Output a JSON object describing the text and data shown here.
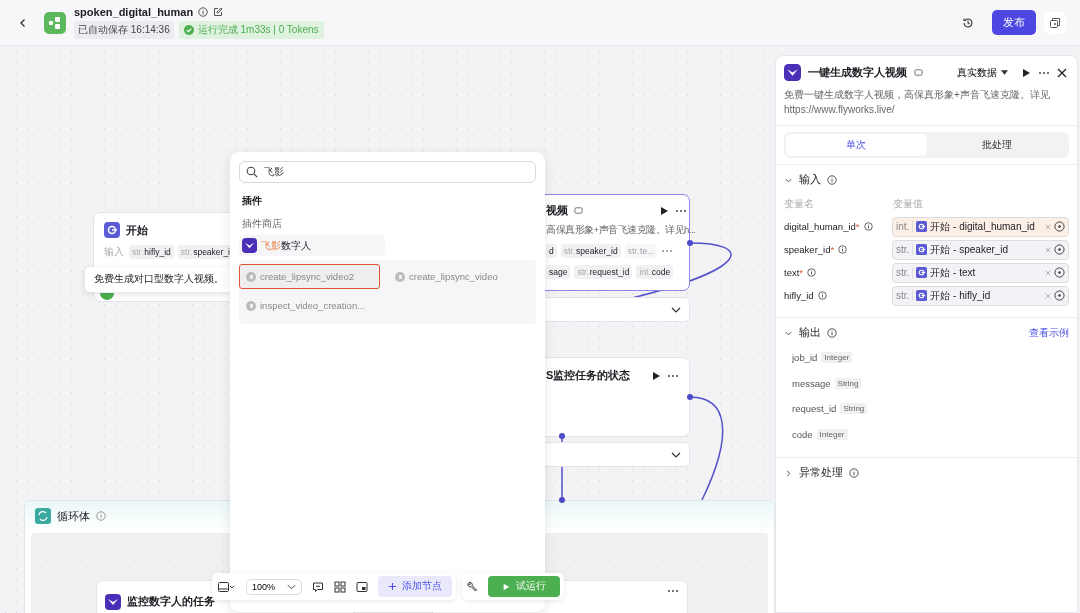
{
  "header": {
    "title": "spoken_digital_human",
    "autosave": "已自动保存 16:14:36",
    "status": "运行完成 1m33s | 0 Tokens",
    "publish": "发布"
  },
  "canvas": {
    "start_node": {
      "title": "开始",
      "input_label": "输入",
      "params": [
        {
          "type": "str.",
          "name": "hifly_id"
        },
        {
          "type": "str.",
          "name": "speaker_i"
        }
      ]
    },
    "tooltip": "免费生成对口型数字人视频。",
    "plugin_node": {
      "title": "视频",
      "description": "高保真形象+声音飞速克隆。详见h...",
      "inputs": [
        {
          "name": "d",
          "faded": false
        },
        {
          "type": "str.",
          "name": "speaker_id",
          "faded": false
        },
        {
          "type": "str.",
          "name": "te...",
          "faded": true
        }
      ],
      "outputs": [
        {
          "name": "sage"
        },
        {
          "type": "str.",
          "name": "request_id"
        },
        {
          "type": "int.",
          "name": "code"
        }
      ]
    },
    "monitor_node": {
      "title": "S监控任务的状态"
    },
    "loop": {
      "title": "循环体",
      "inner_title": "监控数字人的任务"
    }
  },
  "popup": {
    "query": "飞影",
    "section": "插件",
    "subsection": "插件商店",
    "plugin": {
      "match": "飞影",
      "rest": "数字人"
    },
    "tools": [
      {
        "name": "create_lipsync_video2",
        "selected": true
      },
      {
        "name": "create_lipsync_video",
        "selected": false
      },
      {
        "name": "inspect_video_creation...",
        "selected": false
      }
    ]
  },
  "toolbar": {
    "zoom": "100%",
    "add_node": "添加节点",
    "test_run": "试运行"
  },
  "panel": {
    "title": "一键生成数字人视频",
    "data_mode": "真实数据",
    "description": "免费一键生成数字人视频，高保真形象+声音飞速克隆。详见https://www.flyworks.live/",
    "tabs": [
      {
        "label": "单次",
        "selected": true
      },
      {
        "label": "批处理",
        "selected": false
      }
    ],
    "input": {
      "title": "输入",
      "expanded": true,
      "name_header": "变量名",
      "value_header": "变量值",
      "rows": [
        {
          "name": "digital_human_id",
          "required_mark": "*",
          "type": "int.",
          "value": "开始 - digital_human_id",
          "highlighted": true
        },
        {
          "name": "speaker_id",
          "required_mark": "*",
          "type": "str.",
          "value": "开始 - speaker_id",
          "highlighted": false
        },
        {
          "name": "text",
          "required_mark": "*",
          "type": "str.",
          "value": "开始 - text",
          "highlighted": false
        },
        {
          "name": "hifly_id",
          "type": "str.",
          "value": "开始 - hifly_id",
          "highlighted": false
        }
      ]
    },
    "output": {
      "title": "输出",
      "expanded": true,
      "link": "查看示例",
      "fields": [
        {
          "name": "job_id",
          "type": "Integer"
        },
        {
          "name": "message",
          "type": "String"
        },
        {
          "name": "request_id",
          "type": "String"
        },
        {
          "name": "code",
          "type": "Integer"
        }
      ]
    },
    "error": {
      "title": "异常处理",
      "expanded": false
    }
  }
}
